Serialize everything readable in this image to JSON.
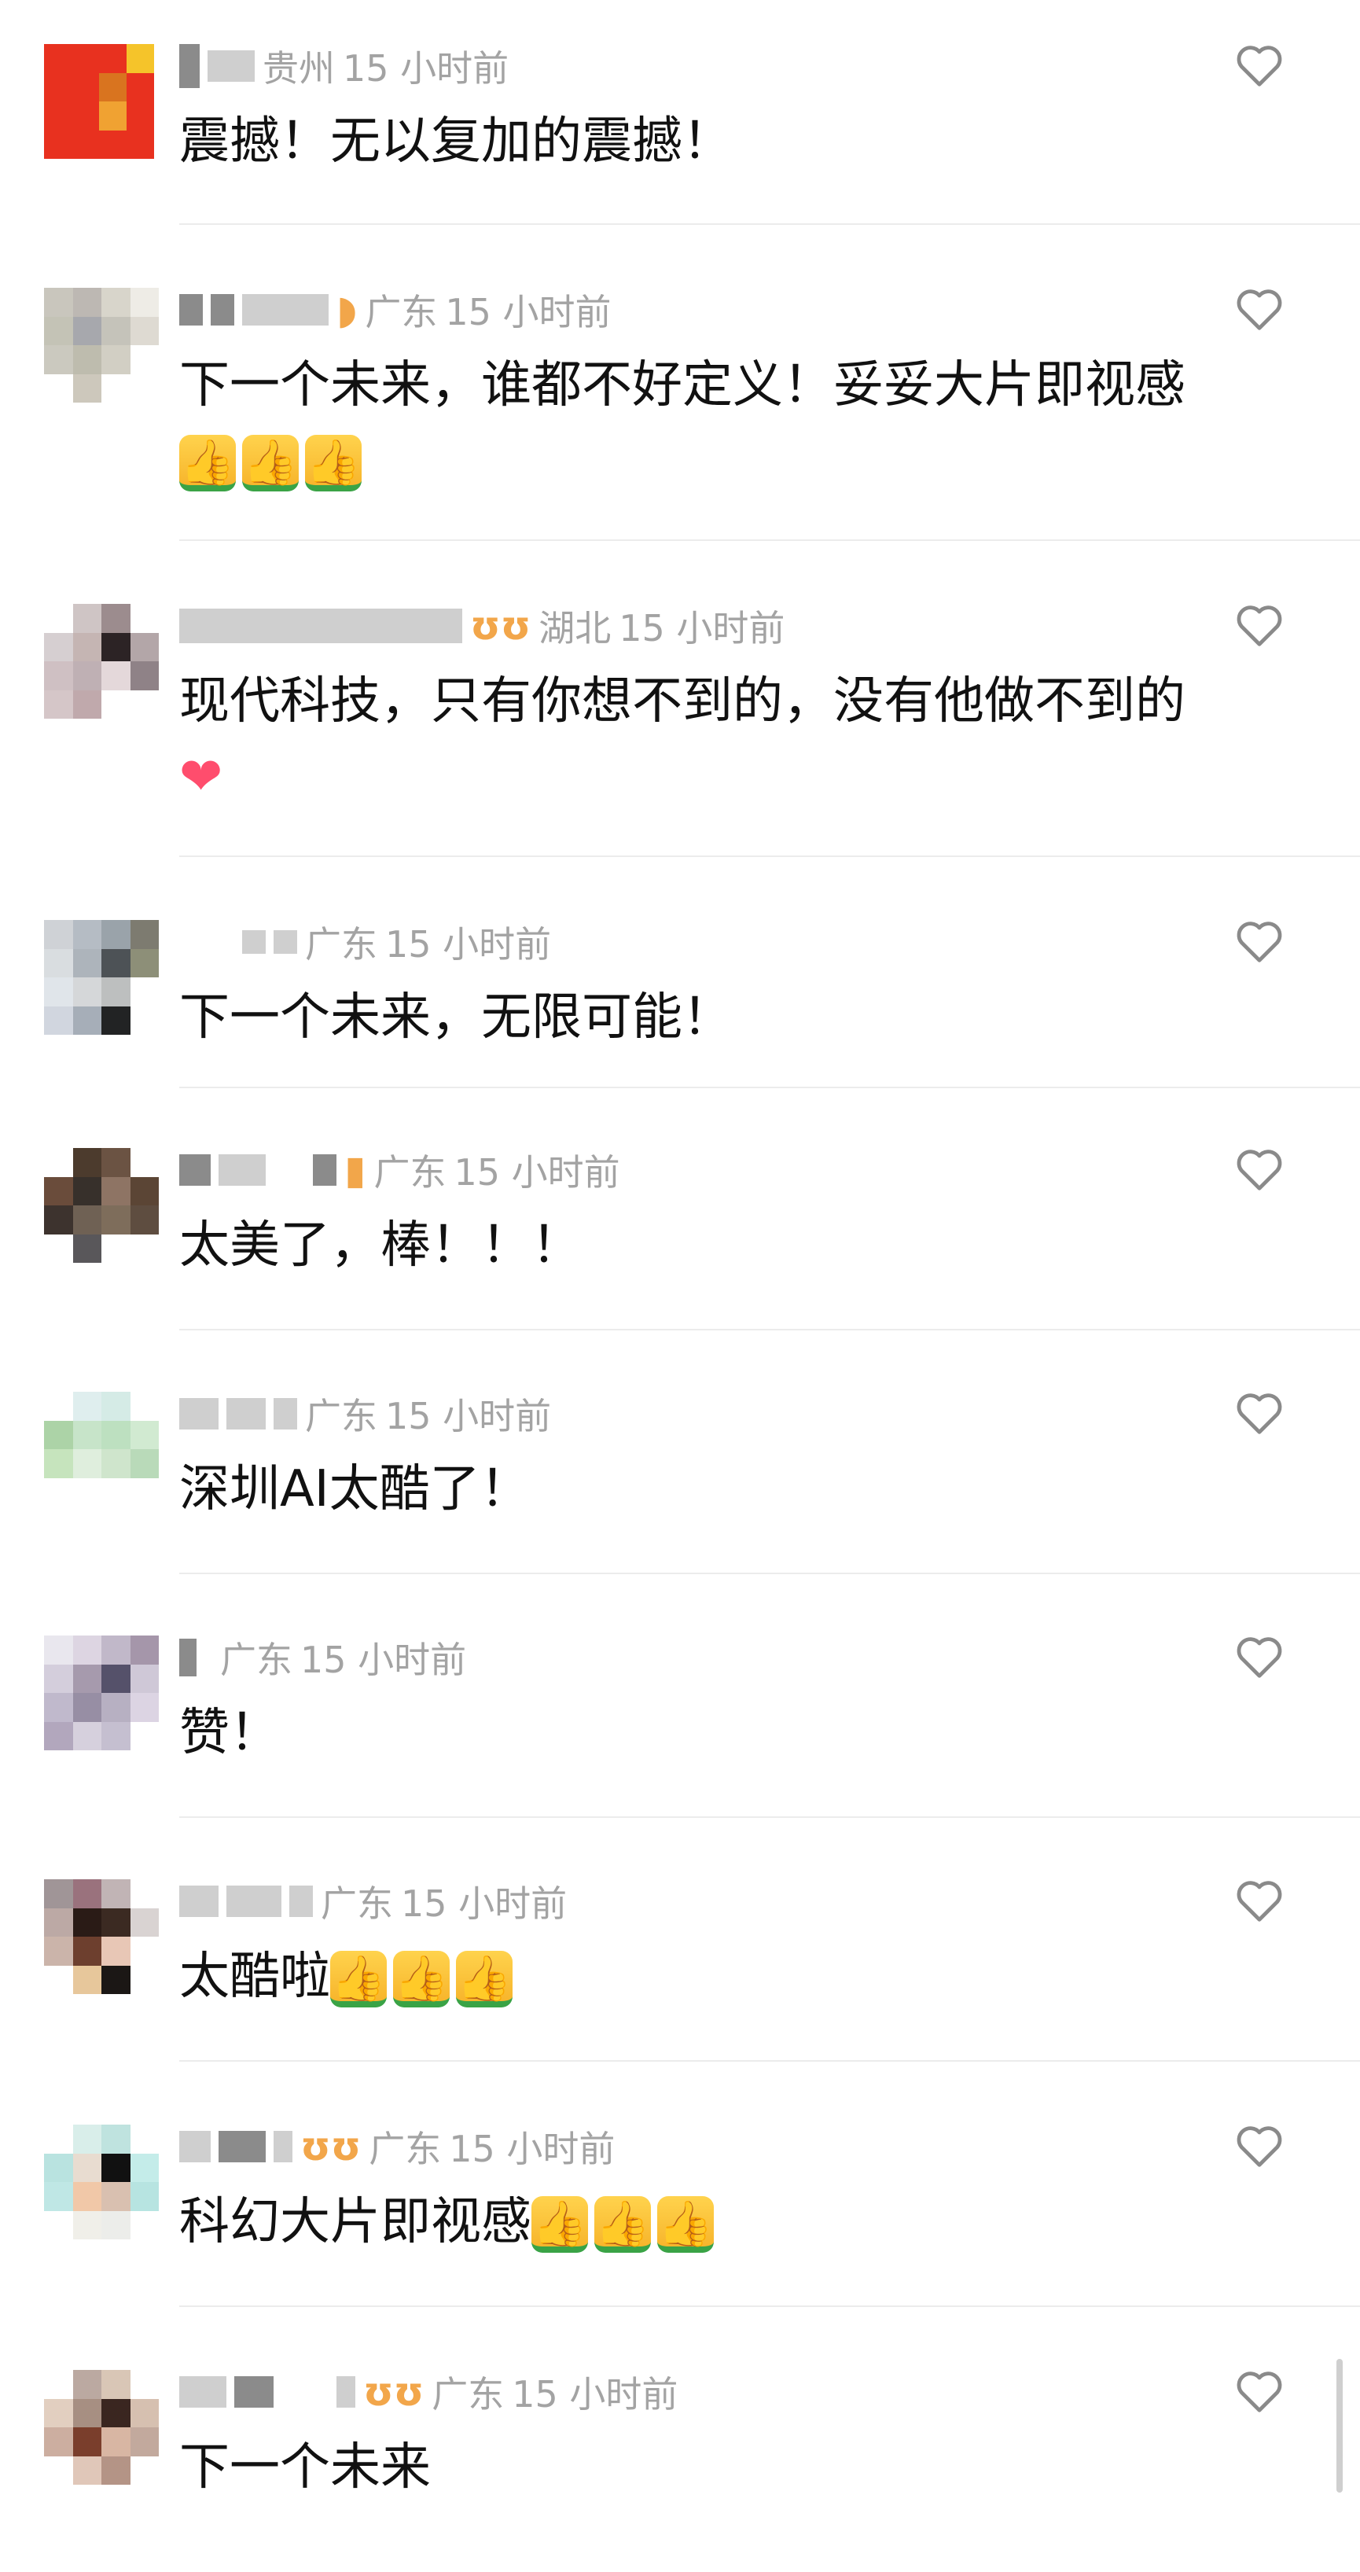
{
  "comments": [
    {
      "location": "贵州",
      "time": "15 小时前",
      "text": "震撼！无以复加的震撼！",
      "emoji": ""
    },
    {
      "location": "广东",
      "time": "15 小时前",
      "text": "下一个未来，谁都不好定义！妥妥大片即视感",
      "emoji": "thumbs-up-x3"
    },
    {
      "location": "湖北",
      "time": "15 小时前",
      "text": "现代科技，只有你想不到的，没有他做不到的",
      "emoji": "heart"
    },
    {
      "location": "广东",
      "time": "15 小时前",
      "text": "下一个未来，无限可能！",
      "emoji": ""
    },
    {
      "location": "广东",
      "time": "15 小时前",
      "text": "太美了，棒！！！",
      "emoji": ""
    },
    {
      "location": "广东",
      "time": "15 小时前",
      "text": "深圳AI太酷了！",
      "emoji": ""
    },
    {
      "location": "广东",
      "time": "15 小时前",
      "text": "赞！",
      "emoji": ""
    },
    {
      "location": "广东",
      "time": "15 小时前",
      "text": "太酷啦",
      "emoji": "thumbs-up-x3"
    },
    {
      "location": "广东",
      "time": "15 小时前",
      "text": "科幻大片即视感",
      "emoji": "thumbs-up-x3"
    },
    {
      "location": "广东",
      "time": "15 小时前",
      "text": "下一个未来",
      "emoji": ""
    }
  ],
  "icons": {
    "like": "heart-outline-icon",
    "thumbs": "thumbs-up-emoji",
    "heart": "red-heart-emoji"
  },
  "colors": {
    "meta": "#a3a3a3",
    "text": "#111111",
    "divider": "#ececec",
    "badge": "#f2a64a"
  }
}
